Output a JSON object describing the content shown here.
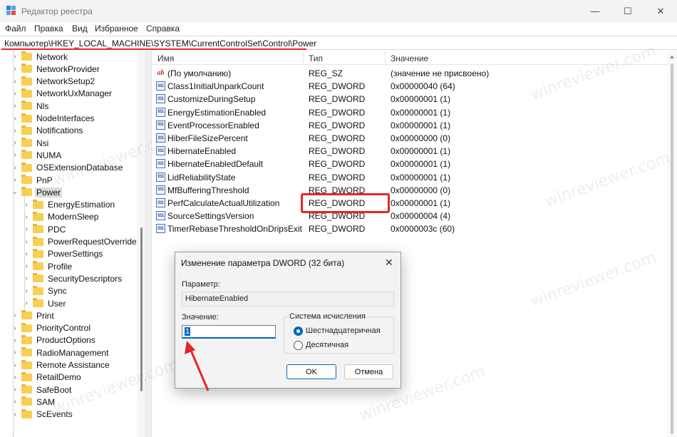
{
  "window": {
    "title": "Редактор реестра",
    "controls": {
      "minimize": "—",
      "maximize": "☐",
      "close": "✕"
    }
  },
  "menu": [
    "Файл",
    "Правка",
    "Вид",
    "Избранное",
    "Справка"
  ],
  "address": "Компьютер\\HKEY_LOCAL_MACHINE\\SYSTEM\\CurrentControlSet\\Control\\Power",
  "tree": {
    "items": [
      {
        "label": "Network",
        "level": 1
      },
      {
        "label": "NetworkProvider",
        "level": 1
      },
      {
        "label": "NetworkSetup2",
        "level": 1
      },
      {
        "label": "NetworkUxManager",
        "level": 1
      },
      {
        "label": "Nls",
        "level": 1
      },
      {
        "label": "NodeInterfaces",
        "level": 1
      },
      {
        "label": "Notifications",
        "level": 1
      },
      {
        "label": "Nsi",
        "level": 1
      },
      {
        "label": "NUMA",
        "level": 1
      },
      {
        "label": "OSExtensionDatabase",
        "level": 1
      },
      {
        "label": "PnP",
        "level": 1
      },
      {
        "label": "Power",
        "level": 1,
        "expanded": true,
        "selected": true
      },
      {
        "label": "EnergyEstimation",
        "level": 2
      },
      {
        "label": "ModernSleep",
        "level": 2
      },
      {
        "label": "PDC",
        "level": 2
      },
      {
        "label": "PowerRequestOverride",
        "level": 2
      },
      {
        "label": "PowerSettings",
        "level": 2
      },
      {
        "label": "Profile",
        "level": 2
      },
      {
        "label": "SecurityDescriptors",
        "level": 2
      },
      {
        "label": "Sync",
        "level": 2
      },
      {
        "label": "User",
        "level": 2
      },
      {
        "label": "Print",
        "level": 1
      },
      {
        "label": "PriorityControl",
        "level": 1
      },
      {
        "label": "ProductOptions",
        "level": 1
      },
      {
        "label": "RadioManagement",
        "level": 1
      },
      {
        "label": "Remote Assistance",
        "level": 1
      },
      {
        "label": "RetailDemo",
        "level": 1
      },
      {
        "label": "SafeBoot",
        "level": 1
      },
      {
        "label": "SAM",
        "level": 1
      },
      {
        "label": "ScEvents",
        "level": 1
      }
    ]
  },
  "values": {
    "columns": [
      "Имя",
      "Тип",
      "Значение"
    ],
    "rows": [
      {
        "name": "(По умолчанию)",
        "type": "REG_SZ",
        "data": "(значение не присвоено)",
        "icon": "string-value-icon"
      },
      {
        "name": "Class1InitialUnparkCount",
        "type": "REG_DWORD",
        "data": "0x00000040 (64)",
        "icon": "dword-value-icon"
      },
      {
        "name": "CustomizeDuringSetup",
        "type": "REG_DWORD",
        "data": "0x00000001 (1)",
        "icon": "dword-value-icon"
      },
      {
        "name": "EnergyEstimationEnabled",
        "type": "REG_DWORD",
        "data": "0x00000001 (1)",
        "icon": "dword-value-icon"
      },
      {
        "name": "EventProcessorEnabled",
        "type": "REG_DWORD",
        "data": "0x00000001 (1)",
        "icon": "dword-value-icon"
      },
      {
        "name": "HiberFileSizePercent",
        "type": "REG_DWORD",
        "data": "0x00000000 (0)",
        "icon": "dword-value-icon"
      },
      {
        "name": "HibernateEnabled",
        "type": "REG_DWORD",
        "data": "0x00000001 (1)",
        "icon": "dword-value-icon",
        "highlighted": true
      },
      {
        "name": "HibernateEnabledDefault",
        "type": "REG_DWORD",
        "data": "0x00000001 (1)",
        "icon": "dword-value-icon"
      },
      {
        "name": "LidReliabilityState",
        "type": "REG_DWORD",
        "data": "0x00000001 (1)",
        "icon": "dword-value-icon"
      },
      {
        "name": "MfBufferingThreshold",
        "type": "REG_DWORD",
        "data": "0x00000000 (0)",
        "icon": "dword-value-icon"
      },
      {
        "name": "PerfCalculateActualUtilization",
        "type": "REG_DWORD",
        "data": "0x00000001 (1)",
        "icon": "dword-value-icon"
      },
      {
        "name": "SourceSettingsVersion",
        "type": "REG_DWORD",
        "data": "0x00000004 (4)",
        "icon": "dword-value-icon"
      },
      {
        "name": "TimerRebaseThresholdOnDripsExit",
        "type": "REG_DWORD",
        "data": "0x0000003c (60)",
        "icon": "dword-value-icon"
      }
    ]
  },
  "dialog": {
    "title": "Изменение параметра DWORD (32 бита)",
    "param_label": "Параметр:",
    "param_value": "HibernateEnabled",
    "value_label": "Значение:",
    "value": "1",
    "base_label": "Система исчисления",
    "base_options": [
      "Шестнадцатеричная",
      "Десятичная"
    ],
    "base_selected": "Шестнадцатеричная",
    "ok": "OK",
    "cancel": "Отмена"
  },
  "watermark": "winreviewer.com",
  "colors": {
    "highlight": "#e3262c",
    "accent": "#0067c0",
    "folder": "#f8cf55"
  }
}
